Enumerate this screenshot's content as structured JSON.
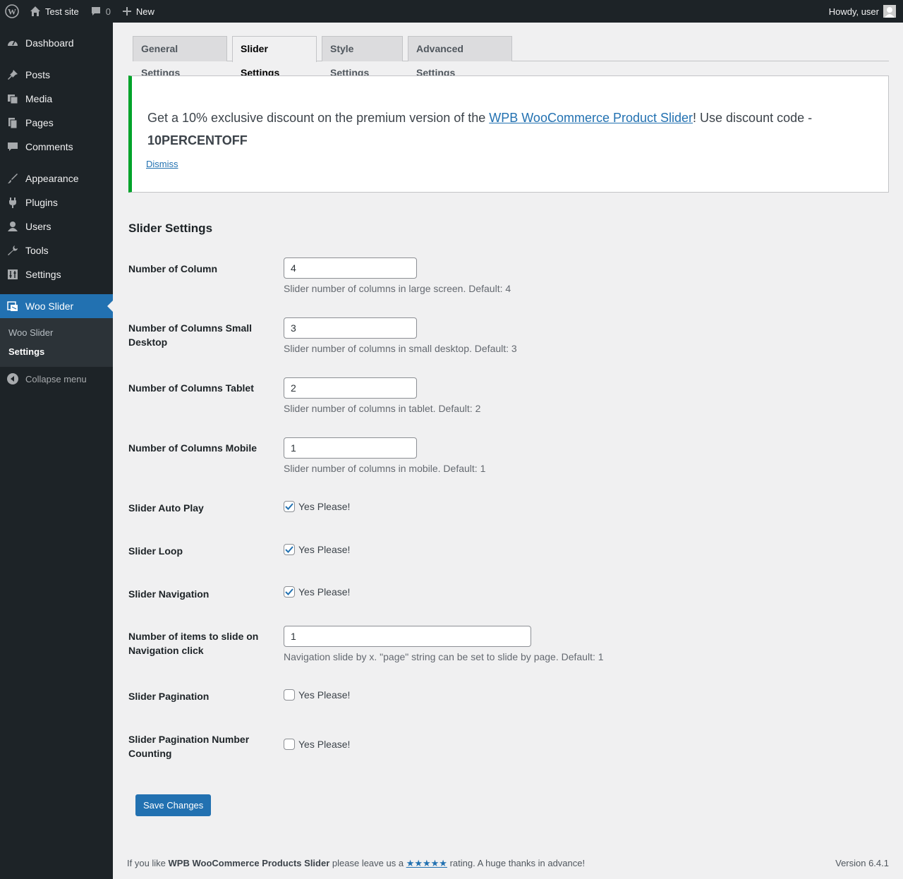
{
  "adminbar": {
    "site_name": "Test site",
    "comments_count": "0",
    "new_label": "New",
    "greeting": "Howdy, user"
  },
  "sidebar": {
    "items": [
      {
        "label": "Dashboard",
        "icon": "dashboard-icon"
      },
      {
        "label": "Posts",
        "icon": "pin-icon"
      },
      {
        "label": "Media",
        "icon": "media-icon"
      },
      {
        "label": "Pages",
        "icon": "pages-icon"
      },
      {
        "label": "Comments",
        "icon": "comments-icon"
      },
      {
        "label": "Appearance",
        "icon": "brush-icon"
      },
      {
        "label": "Plugins",
        "icon": "plugin-icon"
      },
      {
        "label": "Users",
        "icon": "users-icon"
      },
      {
        "label": "Tools",
        "icon": "wrench-icon"
      },
      {
        "label": "Settings",
        "icon": "settings-icon"
      },
      {
        "label": "Woo Slider",
        "icon": "slider-icon"
      }
    ],
    "submenu": [
      "Woo Slider",
      "Settings"
    ],
    "collapse_label": "Collapse menu"
  },
  "tabs": [
    "General Settings",
    "Slider Settings",
    "Style Settings",
    "Advanced Settings"
  ],
  "active_tab": "Slider Settings",
  "notice": {
    "text_before": "Get a 10% exclusive discount on the premium version of the ",
    "link_text": "WPB WooCommerce Product Slider",
    "text_after": "! Use discount code - ",
    "code": "10PERCENTOFF",
    "dismiss": "Dismiss",
    "accent_color": "#00a32a"
  },
  "section_title": "Slider Settings",
  "fields": {
    "columns": {
      "label": "Number of Column",
      "value": "4",
      "desc": "Slider number of columns in large screen. Default: 4"
    },
    "columns_small_desktop": {
      "label": "Number of Columns Small Desktop",
      "value": "3",
      "desc": "Slider number of columns in small desktop. Default: 3"
    },
    "columns_tablet": {
      "label": "Number of Columns Tablet",
      "value": "2",
      "desc": "Slider number of columns in tablet. Default: 2"
    },
    "columns_mobile": {
      "label": "Number of Columns Mobile",
      "value": "1",
      "desc": "Slider number of columns in mobile. Default: 1"
    },
    "auto_play": {
      "label": "Slider Auto Play",
      "checkbox_label": "Yes Please!",
      "checked": true
    },
    "loop": {
      "label": "Slider Loop",
      "checkbox_label": "Yes Please!",
      "checked": true
    },
    "navigation": {
      "label": "Slider Navigation",
      "checkbox_label": "Yes Please!",
      "checked": true
    },
    "slide_by": {
      "label": "Number of items to slide on Navigation click",
      "value": "1",
      "desc": "Navigation slide by x. \"page\" string can be set to slide by page. Default: 1"
    },
    "pagination": {
      "label": "Slider Pagination",
      "checkbox_label": "Yes Please!",
      "checked": false
    },
    "pagination_number": {
      "label": "Slider Pagination Number Counting",
      "checkbox_label": "Yes Please!",
      "checked": false
    }
  },
  "save_label": "Save Changes",
  "footer": {
    "text1": "If you like ",
    "plugin_name": "WPB WooCommerce Products Slider",
    "text2": " please leave us a ",
    "stars": "★★★★★",
    "text3": " rating. A huge thanks in advance!",
    "version": "Version 6.4.1"
  },
  "colors": {
    "primary": "#2271b1",
    "sidebar": "#1d2327",
    "background": "#f0f0f1"
  }
}
